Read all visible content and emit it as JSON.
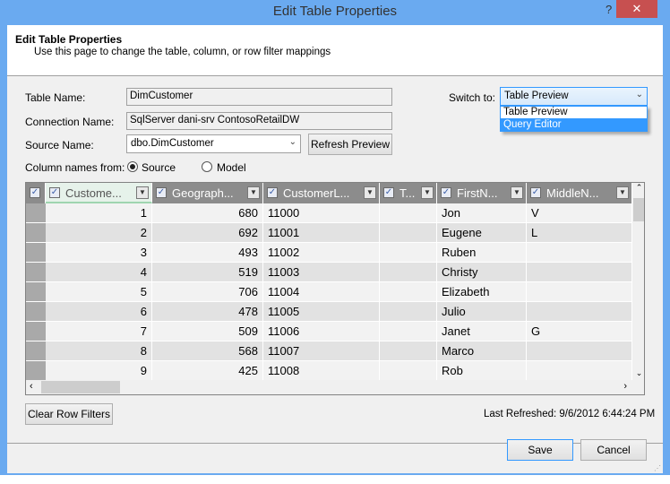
{
  "window": {
    "title": "Edit Table Properties",
    "help": "?",
    "close": "✕"
  },
  "header": {
    "title": "Edit Table Properties",
    "subtitle": "Use this page to change the table, column, or row filter mappings"
  },
  "form": {
    "table_name_label": "Table Name:",
    "table_name": "DimCustomer",
    "connection_name_label": "Connection Name:",
    "connection_name": "SqlServer dani-srv ContosoRetailDW",
    "source_name_label": "Source Name:",
    "source_name": "dbo.DimCustomer",
    "refresh_label": "Refresh Preview",
    "column_names_label": "Column names from:",
    "radio_source": "Source",
    "radio_model": "Model",
    "selected_radio": "Source",
    "switch_label": "Switch to:",
    "switch_value": "Table Preview",
    "switch_options": [
      "Table Preview",
      "Query Editor"
    ],
    "highlighted_option": "Query Editor"
  },
  "grid": {
    "columns": [
      "Custome...",
      "Geograph...",
      "CustomerL...",
      "T...",
      "FirstN...",
      "MiddleN..."
    ],
    "rows": [
      [
        "1",
        "680",
        "11000",
        "",
        "Jon",
        "V"
      ],
      [
        "2",
        "692",
        "11001",
        "",
        "Eugene",
        "L"
      ],
      [
        "3",
        "493",
        "11002",
        "",
        "Ruben",
        ""
      ],
      [
        "4",
        "519",
        "11003",
        "",
        "Christy",
        ""
      ],
      [
        "5",
        "706",
        "11004",
        "",
        "Elizabeth",
        ""
      ],
      [
        "6",
        "478",
        "11005",
        "",
        "Julio",
        ""
      ],
      [
        "7",
        "509",
        "11006",
        "",
        "Janet",
        "G"
      ],
      [
        "8",
        "568",
        "11007",
        "",
        "Marco",
        ""
      ],
      [
        "9",
        "425",
        "11008",
        "",
        "Rob",
        ""
      ]
    ]
  },
  "footer": {
    "clear_filters": "Clear Row Filters",
    "last_refreshed": "Last Refreshed: 9/6/2012 6:44:24 PM",
    "save": "Save",
    "cancel": "Cancel"
  },
  "colors": {
    "titlebar": "#6aaaf0",
    "close": "#c75050",
    "selection": "#3399ff",
    "header_gray": "#8c8c8c"
  }
}
